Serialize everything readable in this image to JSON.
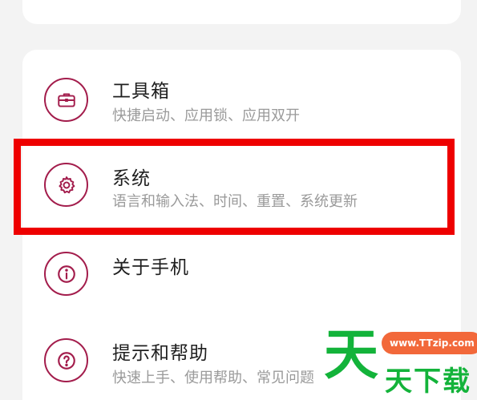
{
  "settings": {
    "items": [
      {
        "title": "工具箱",
        "subtitle": "快捷启动、应用锁、应用双开",
        "icon": "toolbox-icon"
      },
      {
        "title": "系统",
        "subtitle": "语言和输入法、时间、重置、系统更新",
        "icon": "gear-icon"
      },
      {
        "title": "关于手机",
        "subtitle": "",
        "icon": "info-icon"
      },
      {
        "title": "提示和帮助",
        "subtitle": "快速上手、使用帮助、常见问题",
        "icon": "question-icon"
      }
    ]
  },
  "highlight": {
    "color": "#ee0000",
    "target": "系统"
  },
  "watermark": {
    "big": "天",
    "url": "www.TTzip.com",
    "small": "天下载"
  },
  "colors": {
    "accent": "#a31d4c",
    "background": "#f3f3f3",
    "card": "#ffffff"
  }
}
